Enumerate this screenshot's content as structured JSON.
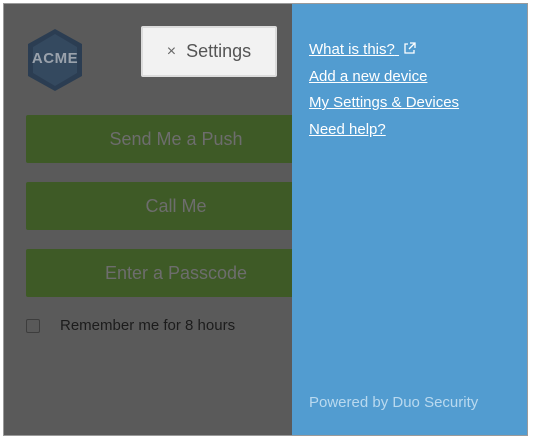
{
  "login": {
    "logo_text": "ACME",
    "settings_button": {
      "close_symbol": "×",
      "label": "Settings"
    },
    "actions": [
      {
        "label": "Send Me a Push"
      },
      {
        "label": "Call Me"
      },
      {
        "label": "Enter a Passcode"
      }
    ],
    "remember_label": "Remember me for 8 hours",
    "remember_checked": false
  },
  "panel": {
    "links": [
      {
        "label": "What is this?",
        "icon": "external-link-icon"
      },
      {
        "label": "Add a new device"
      },
      {
        "label": "My Settings & Devices"
      },
      {
        "label": "Need help?"
      }
    ],
    "footer": "Powered by Duo Security"
  },
  "colors": {
    "panel": "#529cd0",
    "overlay": "#5a5a5a",
    "action_button": "#3e5a26"
  }
}
